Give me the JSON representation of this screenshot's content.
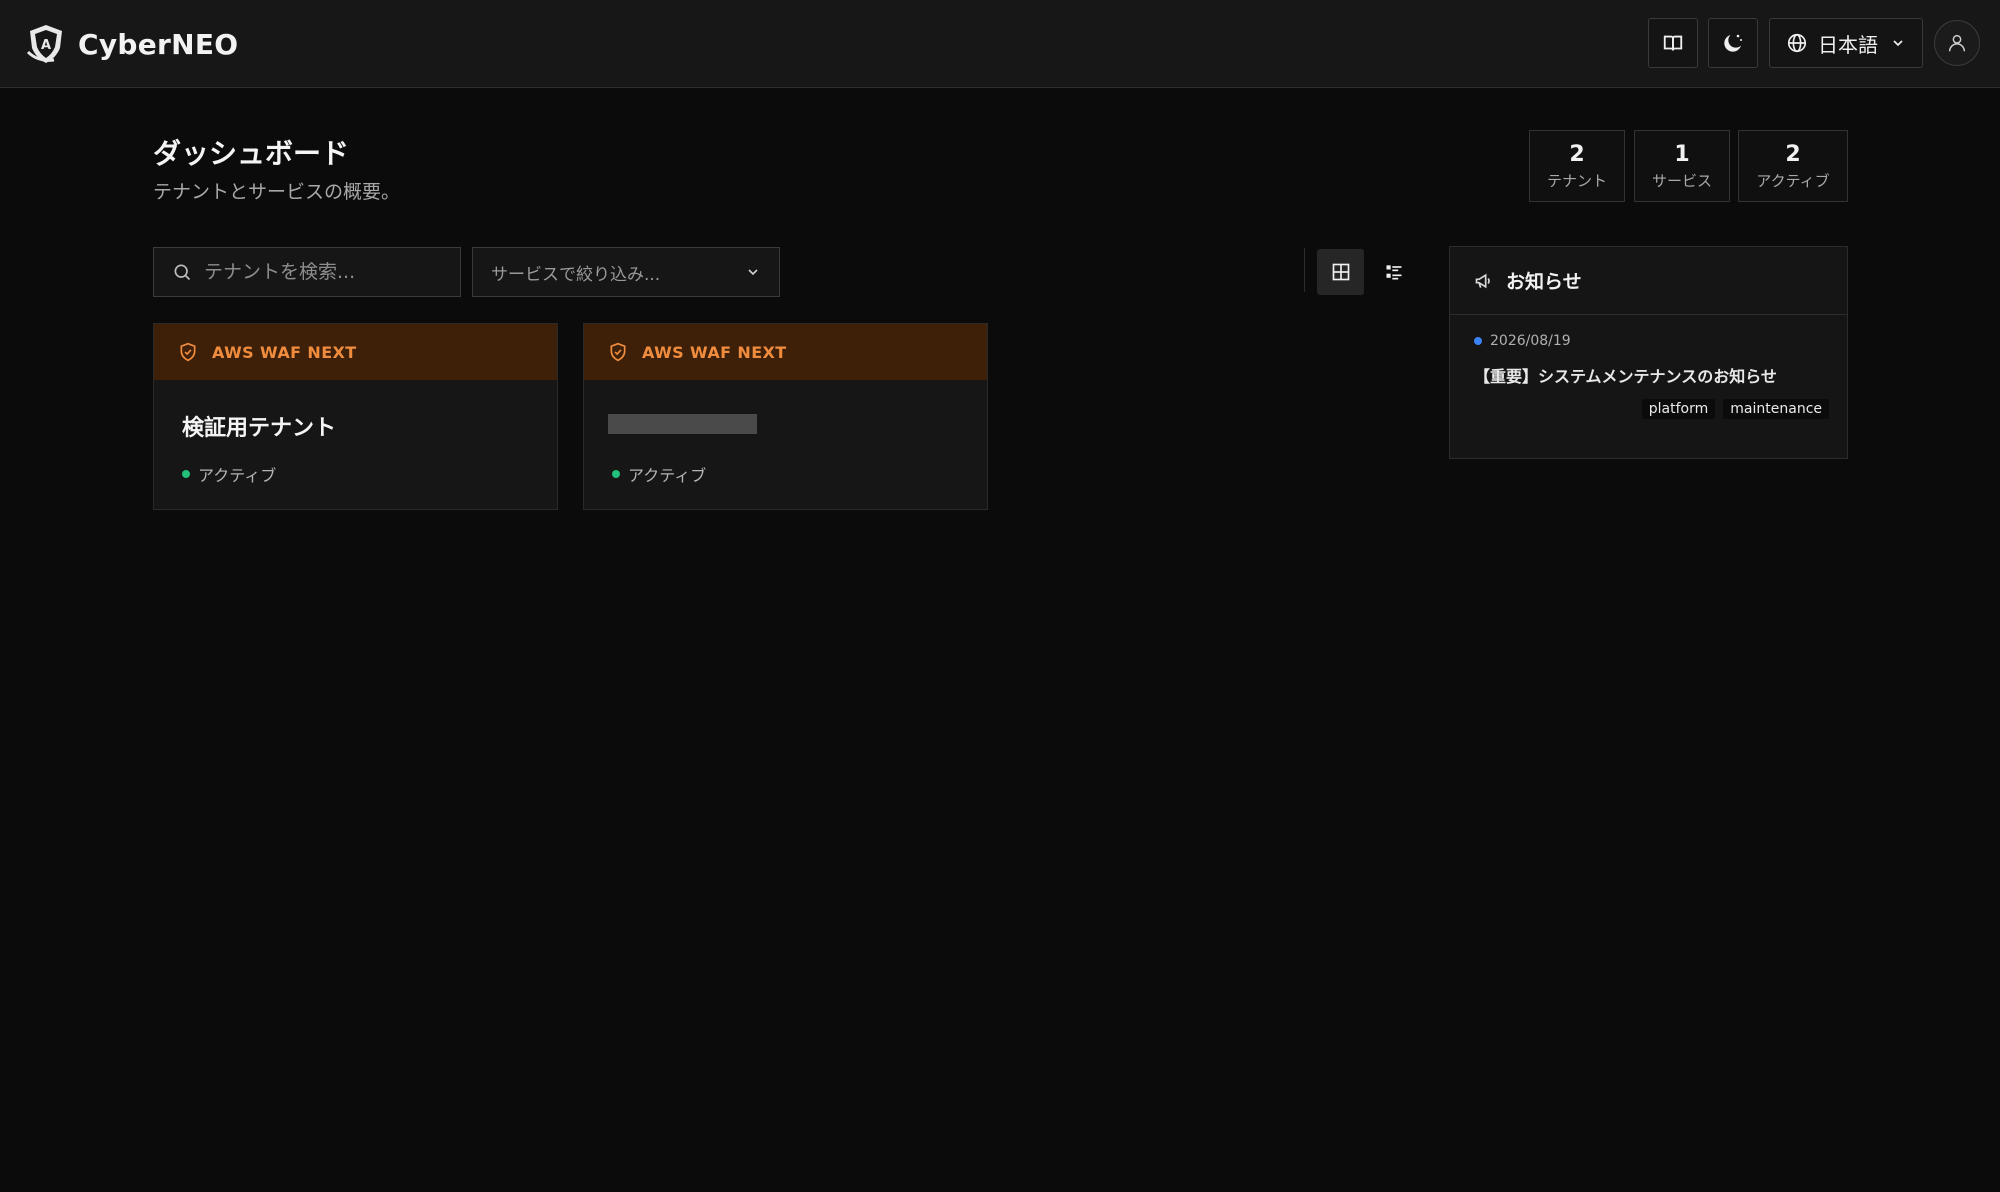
{
  "header": {
    "brand_name": "CyberNEO",
    "language_label": "日本語"
  },
  "page": {
    "title": "ダッシュボード",
    "subtitle": "テナントとサービスの概要。"
  },
  "stats": [
    {
      "value": "2",
      "label": "テナント"
    },
    {
      "value": "1",
      "label": "サービス"
    },
    {
      "value": "2",
      "label": "アクティブ"
    }
  ],
  "toolbar": {
    "search_placeholder": "テナントを検索...",
    "service_filter_label": "サービスで絞り込み..."
  },
  "tenants": [
    {
      "service": "AWS WAF NEXT",
      "name": "検証用テナント",
      "status": "アクティブ"
    },
    {
      "service": "AWS WAF NEXT",
      "name": "",
      "status": "アクティブ"
    }
  ],
  "notices": {
    "title": "お知らせ",
    "items": [
      {
        "date": "2026/08/19",
        "text": "【重要】システムメンテナンスのお知らせ",
        "tags": [
          "platform",
          "maintenance"
        ]
      }
    ]
  },
  "colors": {
    "accent_orange": "#f08c3e",
    "card_header_bg": "#3e2009",
    "status_active": "#22c07a",
    "notice_dot": "#3b82f6"
  },
  "icons": {
    "logo": "shield-logo-icon",
    "docs": "book-open-icon",
    "theme": "moon-icon",
    "language": "globe-icon",
    "user": "user-icon",
    "search": "search-icon",
    "grid_view": "grid-icon",
    "list_view": "list-icon",
    "service": "shield-check-icon",
    "notice": "megaphone-icon"
  }
}
